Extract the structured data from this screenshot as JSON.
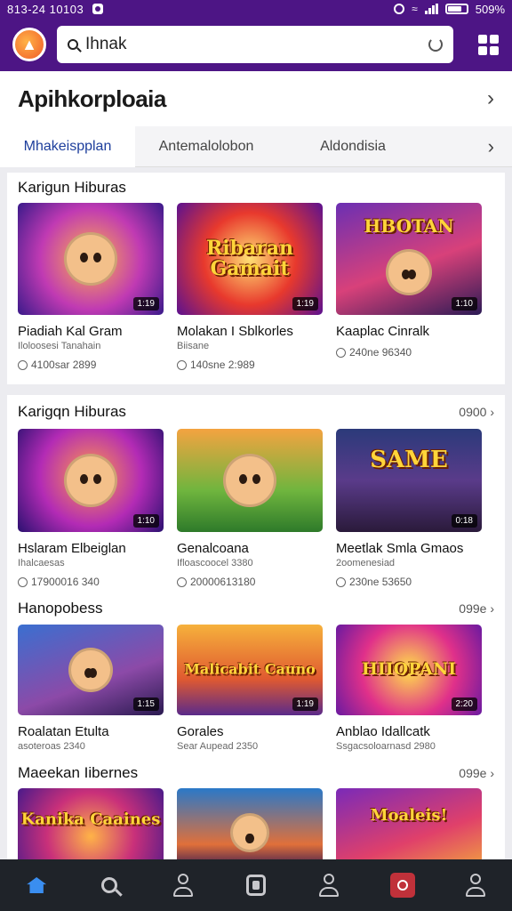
{
  "status_bar": {
    "time": "813-24 10103",
    "battery": "509%"
  },
  "search": {
    "value": "Ihnak"
  },
  "page_title": "Apihkorploaia",
  "tabs": [
    {
      "label": "Mhakeispplan",
      "active": true
    },
    {
      "label": "Antemalolobon",
      "active": false
    },
    {
      "label": "Aldondisia",
      "active": false
    }
  ],
  "sections": [
    {
      "title": "Karigun Hiburas",
      "see_all": "",
      "cards": [
        {
          "title": "Piadiah Kal Gram",
          "sub": "Iloloosesi Tanahain",
          "meta": "4100sar 2899",
          "duration": "1:19",
          "art_text": ""
        },
        {
          "title": "Molakan I Sblkorles",
          "sub": "Biisane",
          "meta": "140sne 2:989",
          "duration": "1:19",
          "art_text": "Ribaran Gamait"
        },
        {
          "title": "Kaaplac Cinralk",
          "sub": "",
          "meta": "240ne 96340",
          "duration": "1:10",
          "art_text": "HBOTAN"
        }
      ]
    },
    {
      "title": "Karigqn Hiburas",
      "see_all": "0900",
      "cards": [
        {
          "title": "Hslaram Elbeiglan",
          "sub": "Ihalcaesas",
          "meta": "17900016 340",
          "duration": "1:10",
          "art_text": ""
        },
        {
          "title": "Genalcoana",
          "sub": "Ifloascoocel 3380",
          "meta": "20000613180",
          "duration": "",
          "art_text": ""
        },
        {
          "title": "Meetlak Smla Gmaos",
          "sub": "2oomenesiad",
          "meta": "230ne 53650",
          "duration": "0:18",
          "art_text": "SAME"
        }
      ]
    },
    {
      "title": "Hanopobess",
      "see_all": "099e",
      "cards": [
        {
          "title": "Roalatan Etulta",
          "sub": "asoteroas 2340",
          "meta": "",
          "duration": "1:15",
          "art_text": ""
        },
        {
          "title": "Gorales",
          "sub": "Sear Aupead 2350",
          "meta": "",
          "duration": "1:19",
          "art_text": "Malicabit Cauno"
        },
        {
          "title": "Anblao Idallcatk",
          "sub": "Ssgacsoloarnasd 2980",
          "meta": "",
          "duration": "2:20",
          "art_text": "HIIOPANI"
        }
      ]
    },
    {
      "title": "Maeekan Iibernes",
      "see_all": "099e",
      "cards": [
        {
          "title": "",
          "sub": "",
          "meta": "",
          "duration": "",
          "art_text": "Kanika Caaines"
        },
        {
          "title": "",
          "sub": "",
          "meta": "",
          "duration": "",
          "art_text": ""
        },
        {
          "title": "",
          "sub": "",
          "meta": "",
          "duration": "",
          "art_text": "Moaleis!"
        }
      ]
    }
  ],
  "bottom_nav": [
    {
      "icon": "home-icon",
      "active": true
    },
    {
      "icon": "search-icon",
      "active": false
    },
    {
      "icon": "profile-icon",
      "active": false
    },
    {
      "icon": "library-icon",
      "active": false
    },
    {
      "icon": "account-icon",
      "active": false
    },
    {
      "icon": "record-icon",
      "active": false
    },
    {
      "icon": "user-icon",
      "active": false
    }
  ],
  "colors": {
    "brand": "#4d1585",
    "nav_bg": "#1f2329",
    "tab_active": "#1d3e9c",
    "home_active": "#3a8ef0"
  }
}
